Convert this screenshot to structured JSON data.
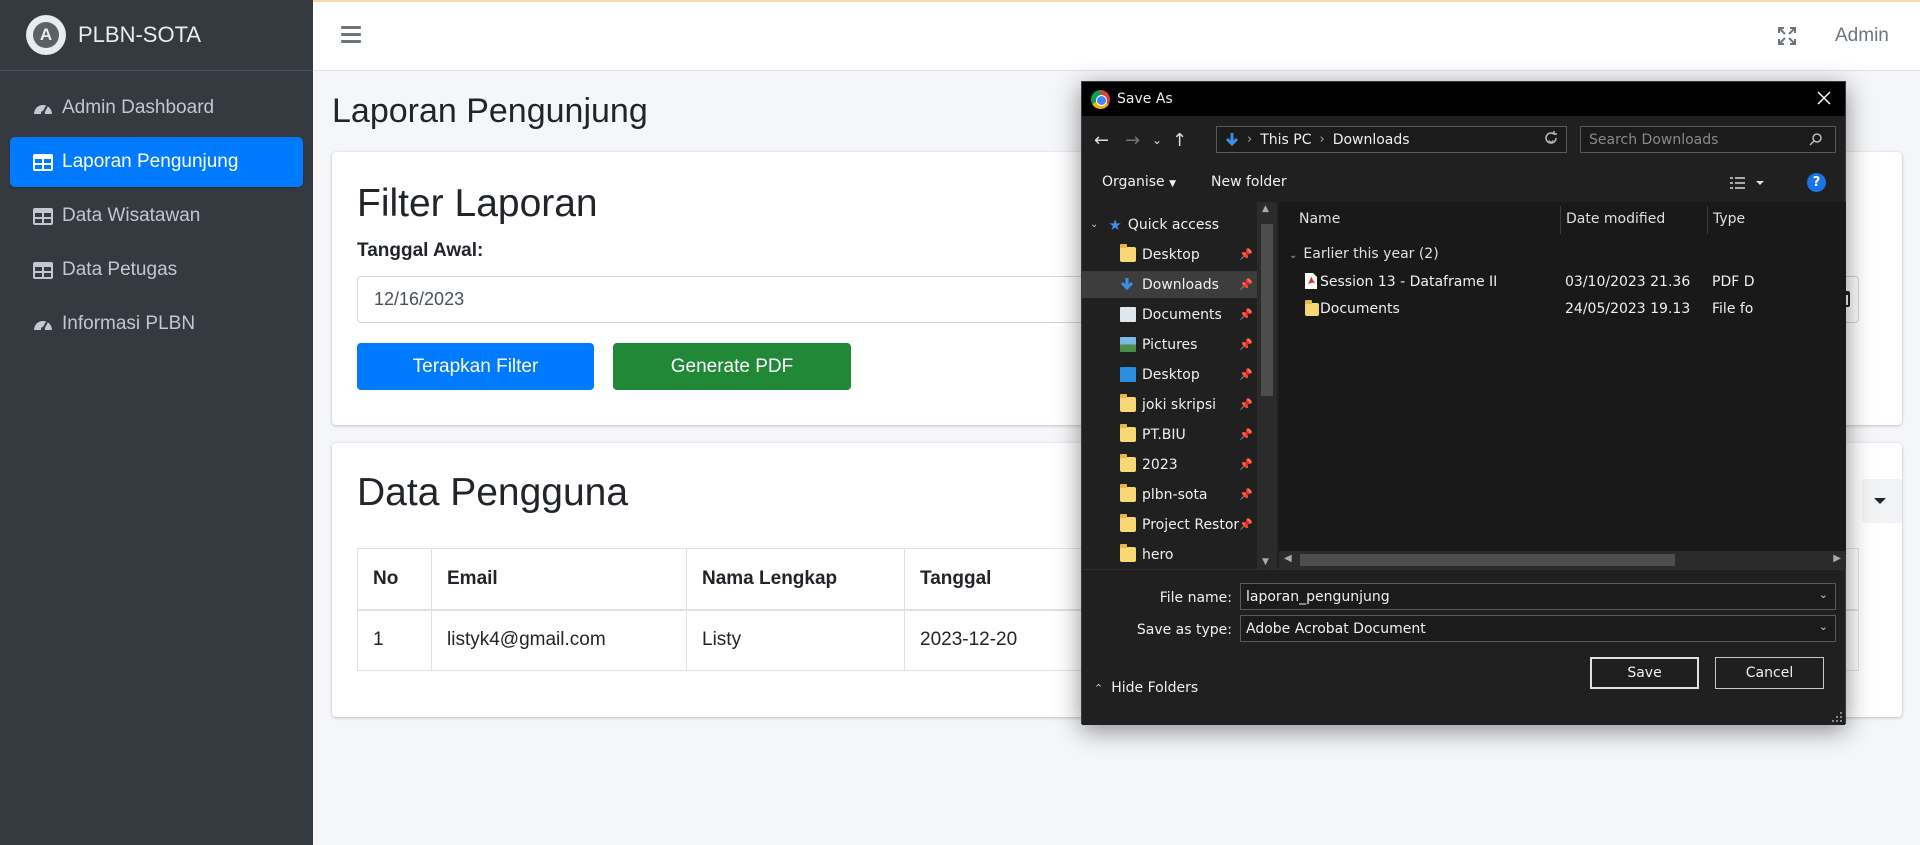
{
  "brand": {
    "name": "PLBN-SOTA",
    "logo_letter": "A"
  },
  "sidebar": {
    "items": [
      {
        "label": "Admin Dashboard",
        "icon": "tachometer-icon",
        "active": false
      },
      {
        "label": "Laporan Pengunjung",
        "icon": "table-icon",
        "active": true
      },
      {
        "label": "Data Wisatawan",
        "icon": "table-icon",
        "active": false
      },
      {
        "label": "Data Petugas",
        "icon": "table-icon",
        "active": false
      },
      {
        "label": "Informasi PLBN",
        "icon": "tachometer-icon",
        "active": false
      }
    ]
  },
  "topbar": {
    "user": "Admin"
  },
  "page": {
    "title": "Laporan Pengunjung"
  },
  "filter": {
    "title": "Filter Laporan",
    "date_label": "Tanggal Awal:",
    "date_value": "12/16/2023",
    "apply_label": "Terapkan Filter",
    "pdf_label": "Generate PDF"
  },
  "data_table": {
    "title": "Data Pengguna",
    "headers": [
      "No",
      "Email",
      "Nama Lengkap",
      "Tanggal"
    ],
    "rows": [
      [
        "1",
        "listyk4@gmail.com",
        "Listy",
        "2023-12-20"
      ]
    ]
  },
  "save_dialog": {
    "title": "Save As",
    "path": [
      "This PC",
      "Downloads"
    ],
    "search_placeholder": "Search Downloads",
    "organise_label": "Organise",
    "new_folder_label": "New folder",
    "help_label": "?",
    "quick_access_label": "Quick access",
    "tree": [
      {
        "label": "Desktop",
        "icon": "folder-icon",
        "pinned": true,
        "selected": false
      },
      {
        "label": "Downloads",
        "icon": "download-icon",
        "pinned": true,
        "selected": true
      },
      {
        "label": "Documents",
        "icon": "document-icon",
        "pinned": true,
        "selected": false
      },
      {
        "label": "Pictures",
        "icon": "picture-icon",
        "pinned": true,
        "selected": false
      },
      {
        "label": "Desktop",
        "icon": "desktop-icon",
        "pinned": true,
        "selected": false
      },
      {
        "label": "joki skripsi",
        "icon": "folder-icon",
        "pinned": true,
        "selected": false
      },
      {
        "label": "PT.BIU",
        "icon": "folder-icon",
        "pinned": true,
        "selected": false
      },
      {
        "label": "2023",
        "icon": "folder-icon",
        "pinned": true,
        "selected": false
      },
      {
        "label": "plbn-sota",
        "icon": "folder-icon",
        "pinned": true,
        "selected": false
      },
      {
        "label": "Project Restor",
        "icon": "folder-icon",
        "pinned": true,
        "selected": false
      },
      {
        "label": "hero",
        "icon": "folder-icon",
        "pinned": false,
        "selected": false
      }
    ],
    "columns": [
      "Name",
      "Date modified",
      "Type"
    ],
    "group_label": "Earlier this year (2)",
    "files": [
      {
        "name": "Session 13 - Dataframe II",
        "date": "03/10/2023 21.36",
        "type": "PDF D",
        "icon": "pdf-icon"
      },
      {
        "name": "Documents",
        "date": "24/05/2023 19.13",
        "type": "File fo",
        "icon": "folder-icon"
      }
    ],
    "file_name_label": "File name:",
    "file_name_value": "laporan_pengunjung",
    "save_type_label": "Save as type:",
    "save_type_value": "Adobe Acrobat Document",
    "hide_folders_label": "Hide Folders",
    "save_label": "Save",
    "cancel_label": "Cancel"
  }
}
